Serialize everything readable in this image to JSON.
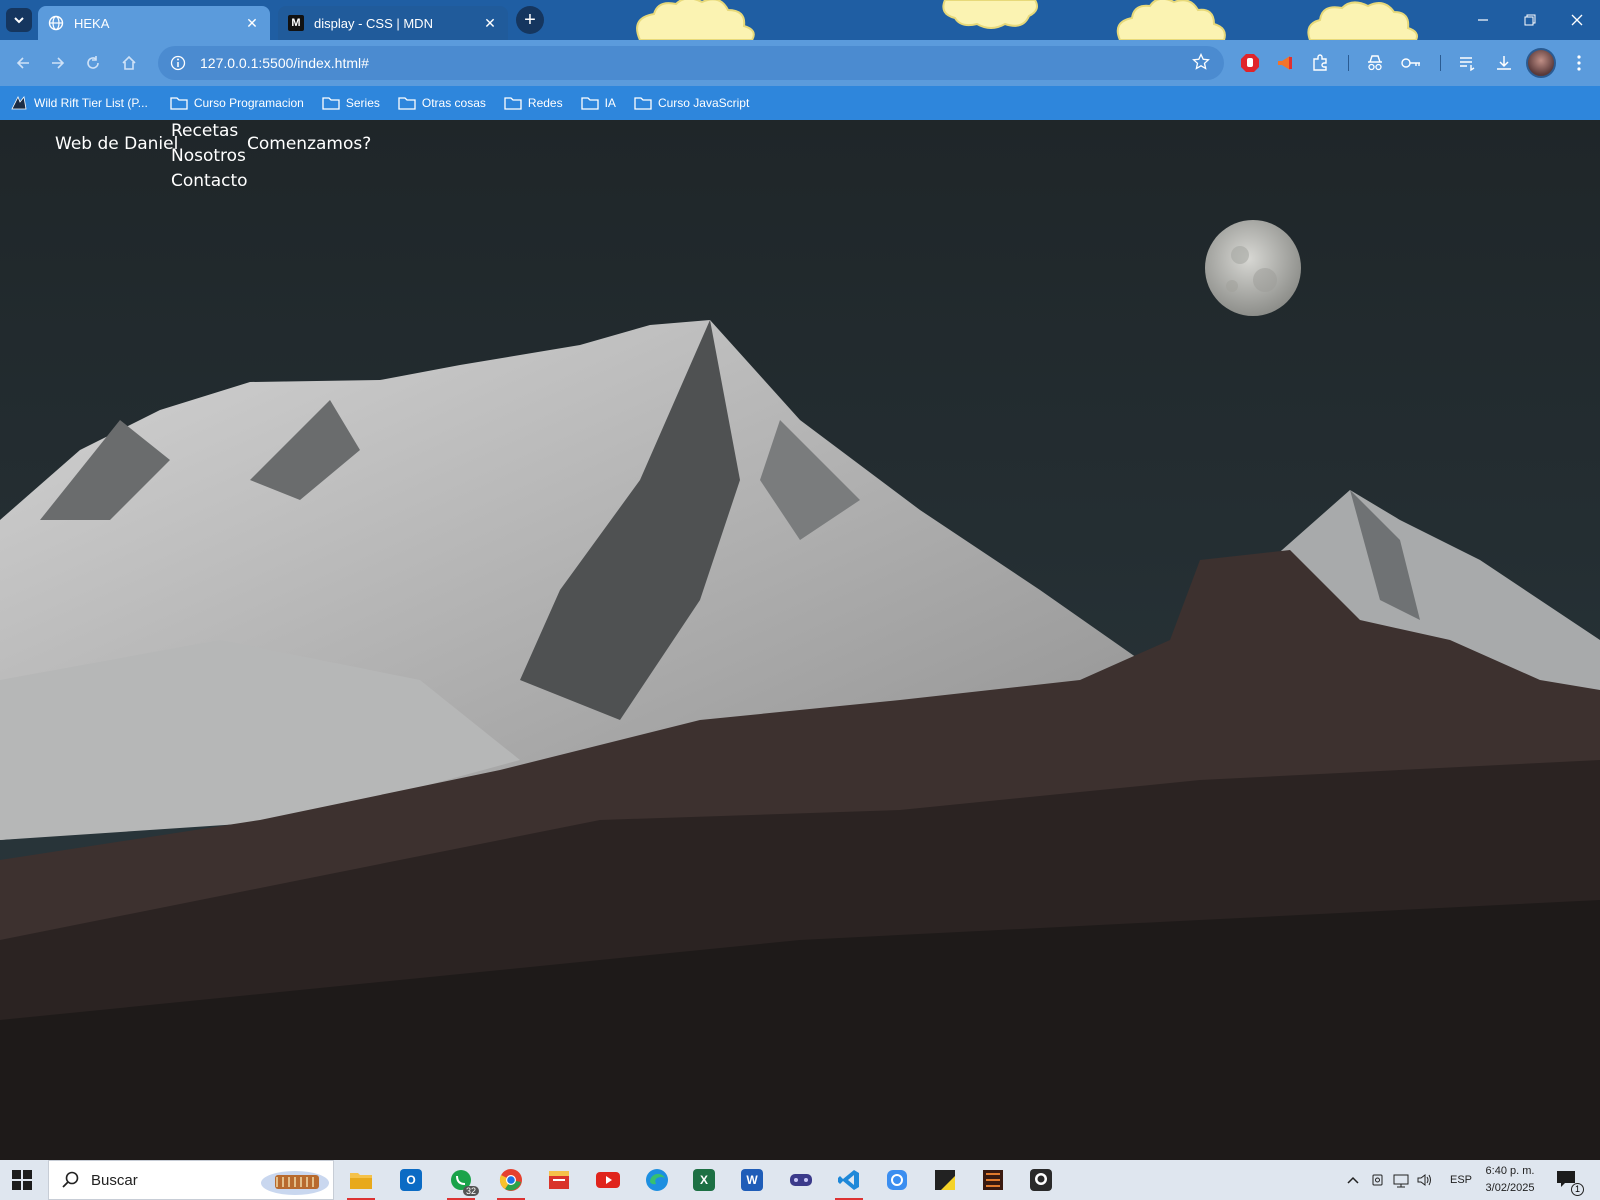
{
  "browser": {
    "tabs": [
      {
        "title": "HEKA",
        "active": true,
        "favicon": "globe-icon"
      },
      {
        "title": "display - CSS | MDN",
        "active": false,
        "favicon": "mdn-icon",
        "favicon_text": "M"
      }
    ],
    "address": "127.0.0.1:5500/index.html#",
    "bookmarks": [
      {
        "label": "Wild Rift Tier List (P...",
        "icon": "site-icon"
      },
      {
        "label": "Curso Programacion",
        "icon": "folder-icon"
      },
      {
        "label": "Series",
        "icon": "folder-icon"
      },
      {
        "label": "Otras cosas",
        "icon": "folder-icon"
      },
      {
        "label": "Redes",
        "icon": "folder-icon"
      },
      {
        "label": "IA",
        "icon": "folder-icon"
      },
      {
        "label": "Curso JavaScript",
        "icon": "folder-icon"
      }
    ]
  },
  "site": {
    "brand": "Web de Daniel",
    "menu": [
      "Recetas",
      "Nosotros",
      "Contacto"
    ],
    "cta": "Comenzamos?"
  },
  "taskbar": {
    "search_label": "Buscar",
    "whatsapp_badge": "32",
    "language": "ESP",
    "time": "6:40 p. m.",
    "date": "3/02/2025",
    "notification_count": "1"
  },
  "colors": {
    "tabstrip": "#1f5ea3",
    "toolbar": "#5b9bdc",
    "bookmarks_bar": "#2e86dc",
    "sky": "#232a2e",
    "taskbar": "#dfe6ef"
  }
}
